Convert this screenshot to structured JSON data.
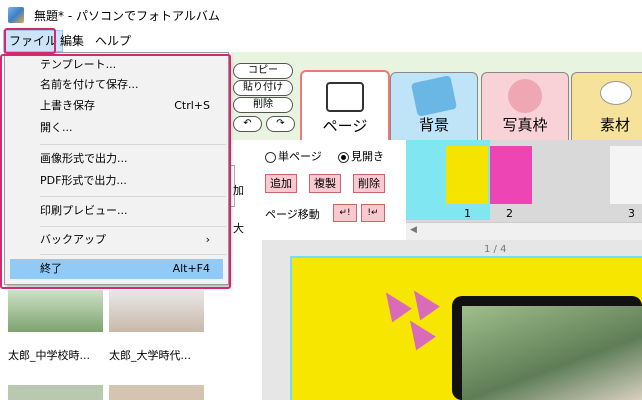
{
  "window": {
    "title": "無題* - パソコンでフォトアルバム"
  },
  "menubar": {
    "file": "ファイル",
    "edit": "編集",
    "help": "ヘルプ"
  },
  "file_menu": {
    "items": [
      {
        "label": "テンプレート...",
        "shortcut": ""
      },
      {
        "label": "名前を付けて保存...",
        "shortcut": ""
      },
      {
        "label": "上書き保存",
        "shortcut": "Ctrl+S"
      },
      {
        "label": "開く...",
        "shortcut": ""
      },
      {
        "label": "画像形式で出力...",
        "shortcut": ""
      },
      {
        "label": "PDF形式で出力...",
        "shortcut": ""
      },
      {
        "label": "印刷プレビュー...",
        "shortcut": ""
      },
      {
        "label": "バックアップ",
        "shortcut": ""
      },
      {
        "label": "終了",
        "shortcut": "Alt+F4"
      }
    ],
    "submenu_arrow": "›",
    "highlighted_item": "終了"
  },
  "toolbar": {
    "copy": "コピー",
    "paste": "貼り付け",
    "delete": "削除",
    "undo_icon": "undo-icon",
    "redo_icon": "redo-icon",
    "undo_glyph": "↶",
    "redo_glyph": "↷"
  },
  "tabs": [
    {
      "label": "ページ",
      "icon": "book-icon",
      "selected": true
    },
    {
      "label": "背景",
      "icon": "background-icon",
      "selected": false
    },
    {
      "label": "写真枠",
      "icon": "photo-frame-icon",
      "selected": false
    },
    {
      "label": "素材",
      "icon": "material-icon",
      "selected": false
    }
  ],
  "page_controls": {
    "single_page": "単ページ",
    "spread": "見開き",
    "spread_selected": true,
    "add": "追加",
    "duplicate": "複製",
    "delete": "削除",
    "page_move": "ページ移動",
    "move_left_glyph": "↵!",
    "move_right_glyph": "!↵"
  },
  "thumbnails": {
    "numbers": [
      "1",
      "2",
      "3"
    ]
  },
  "canvas": {
    "page_indicator": "1 / 4"
  },
  "left_panel": {
    "partial_a": "加",
    "partial_b": "大",
    "captions": [
      "太郎_中学校時...",
      "太郎_大学時代..."
    ]
  },
  "colors": {
    "highlight": "#d12b6d",
    "menu_hover": "#91c9f7",
    "page_yellow": "#f7e600"
  }
}
